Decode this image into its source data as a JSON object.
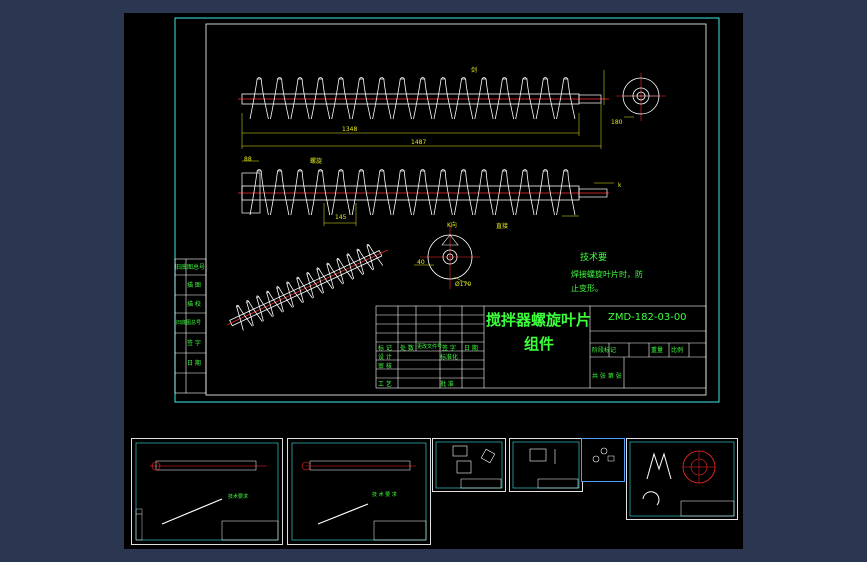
{
  "drawing": {
    "title_line1": "搅拌器螺旋叶片",
    "title_line2": "组件",
    "drawing_no": "ZMD-182-03-00",
    "tech_req_title": "技术要",
    "tech_req_line1": "焊接螺旋叶片时，防",
    "tech_req_line2": "止变形。",
    "dimensions": {
      "d1348": "1348",
      "d1487": "1487",
      "d88": "88",
      "d145": "145",
      "d40": "40",
      "d170": "Ø170",
      "d180": "180",
      "lbl_k": "k",
      "lbl_kdir": "K向",
      "lbl_d": "d",
      "lbl_jian": "剑",
      "lbl_luoxuan": "螺旋",
      "lbl_zhijie": "直接"
    },
    "side_table": [
      "旧底图总号",
      "描 图",
      "描 校",
      "旧底图总号",
      "签 字",
      "日 期"
    ],
    "side_table_header": "旧底图总号",
    "title_block": {
      "rows_labels": [
        "标 记",
        "处 数",
        "更改文件号",
        "签 字",
        "日 期"
      ],
      "designer": "设 计",
      "checker": "审 核",
      "approver": "工 艺",
      "std": "标准化",
      "approve": "批 准",
      "date": "日 期",
      "stage": "阶段标记",
      "weight": "重量",
      "scale": "比例",
      "scale_val": "1:5",
      "sheet": "共 张  第 张"
    }
  },
  "thumbnails": [
    {
      "name": "sheet-1",
      "title": "技术要求"
    },
    {
      "name": "sheet-2",
      "title": "技 术 要 求"
    },
    {
      "name": "sheet-3",
      "title": ""
    },
    {
      "name": "sheet-4",
      "title": ""
    },
    {
      "name": "sheet-5",
      "title": ""
    },
    {
      "name": "sheet-6",
      "title": ""
    }
  ],
  "colors": {
    "frame": "#3ee8e8",
    "geometry": "#ffffff",
    "centerline": "#ff2a2a",
    "dimension": "#e8ec1a",
    "text": "#3cff3c",
    "table": "#ffffff"
  }
}
